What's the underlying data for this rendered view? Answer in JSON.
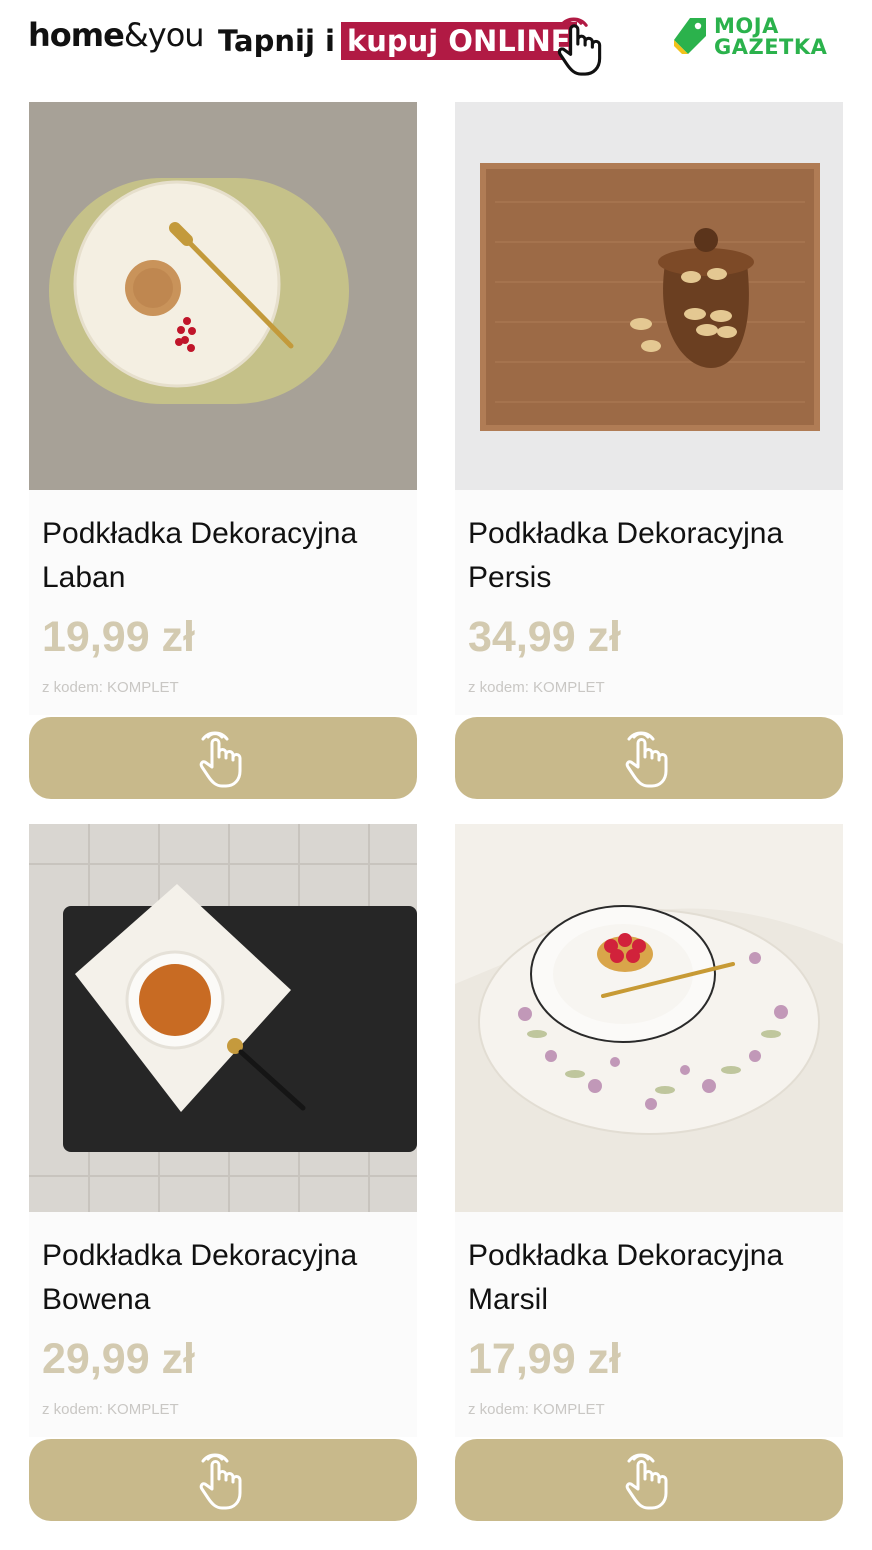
{
  "header": {
    "logo_bold": "home",
    "logo_light": "&you",
    "tap_text": "Tapnij i",
    "tap_highlight": "kupuj ONLINE",
    "gazetka_line1": "MOJA",
    "gazetka_line2": "GAZETKA",
    "hand_icon": "tap-hand-icon"
  },
  "colors": {
    "accent_red": "#b11a44",
    "button_gold": "#c8b98b",
    "price_beige": "#d3cab0",
    "gazetka_green": "#2bb24c"
  },
  "products": [
    {
      "name": "Podkładka Dekoracyjna Laban",
      "price": "19,99 zł",
      "code": "z kodem: KOMPLET"
    },
    {
      "name": "Podkładka Dekoracyjna Persis",
      "price": "34,99 zł",
      "code": "z kodem: KOMPLET"
    },
    {
      "name": "Podkładka Dekoracyjna Bowena",
      "price": "29,99 zł",
      "code": "z kodem: KOMPLET"
    },
    {
      "name": "Podkładka Dekoracyjna Marsil",
      "price": "17,99 zł",
      "code": "z kodem: KOMPLET"
    }
  ]
}
